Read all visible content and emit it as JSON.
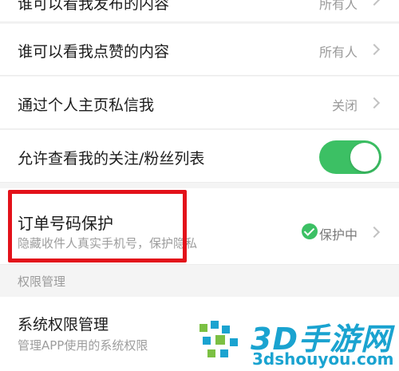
{
  "rows": [
    {
      "title": "谁可以看我发布的内容",
      "value": "所有人"
    },
    {
      "title": "谁可以看我点赞的内容",
      "value": "所有人"
    },
    {
      "title": "通过个人主页私信我",
      "value": "关闭"
    },
    {
      "title": "允许查看我的关注/粉丝列表",
      "toggle": "on"
    },
    {
      "title": "订单号码保护",
      "subtitle": "隐藏收件人真实手机号，保护隐私",
      "value": "保护中"
    }
  ],
  "section_label": "权限管理",
  "system": {
    "title": "系统权限管理",
    "subtitle": "管理APP使用的系统权限"
  },
  "watermark": {
    "brand": "3D手游网",
    "url": "3dshouyou.com"
  },
  "colors": {
    "toggle_on": "#3cc064",
    "highlight": "#e3121a",
    "watermark": "#1aa3d0"
  }
}
